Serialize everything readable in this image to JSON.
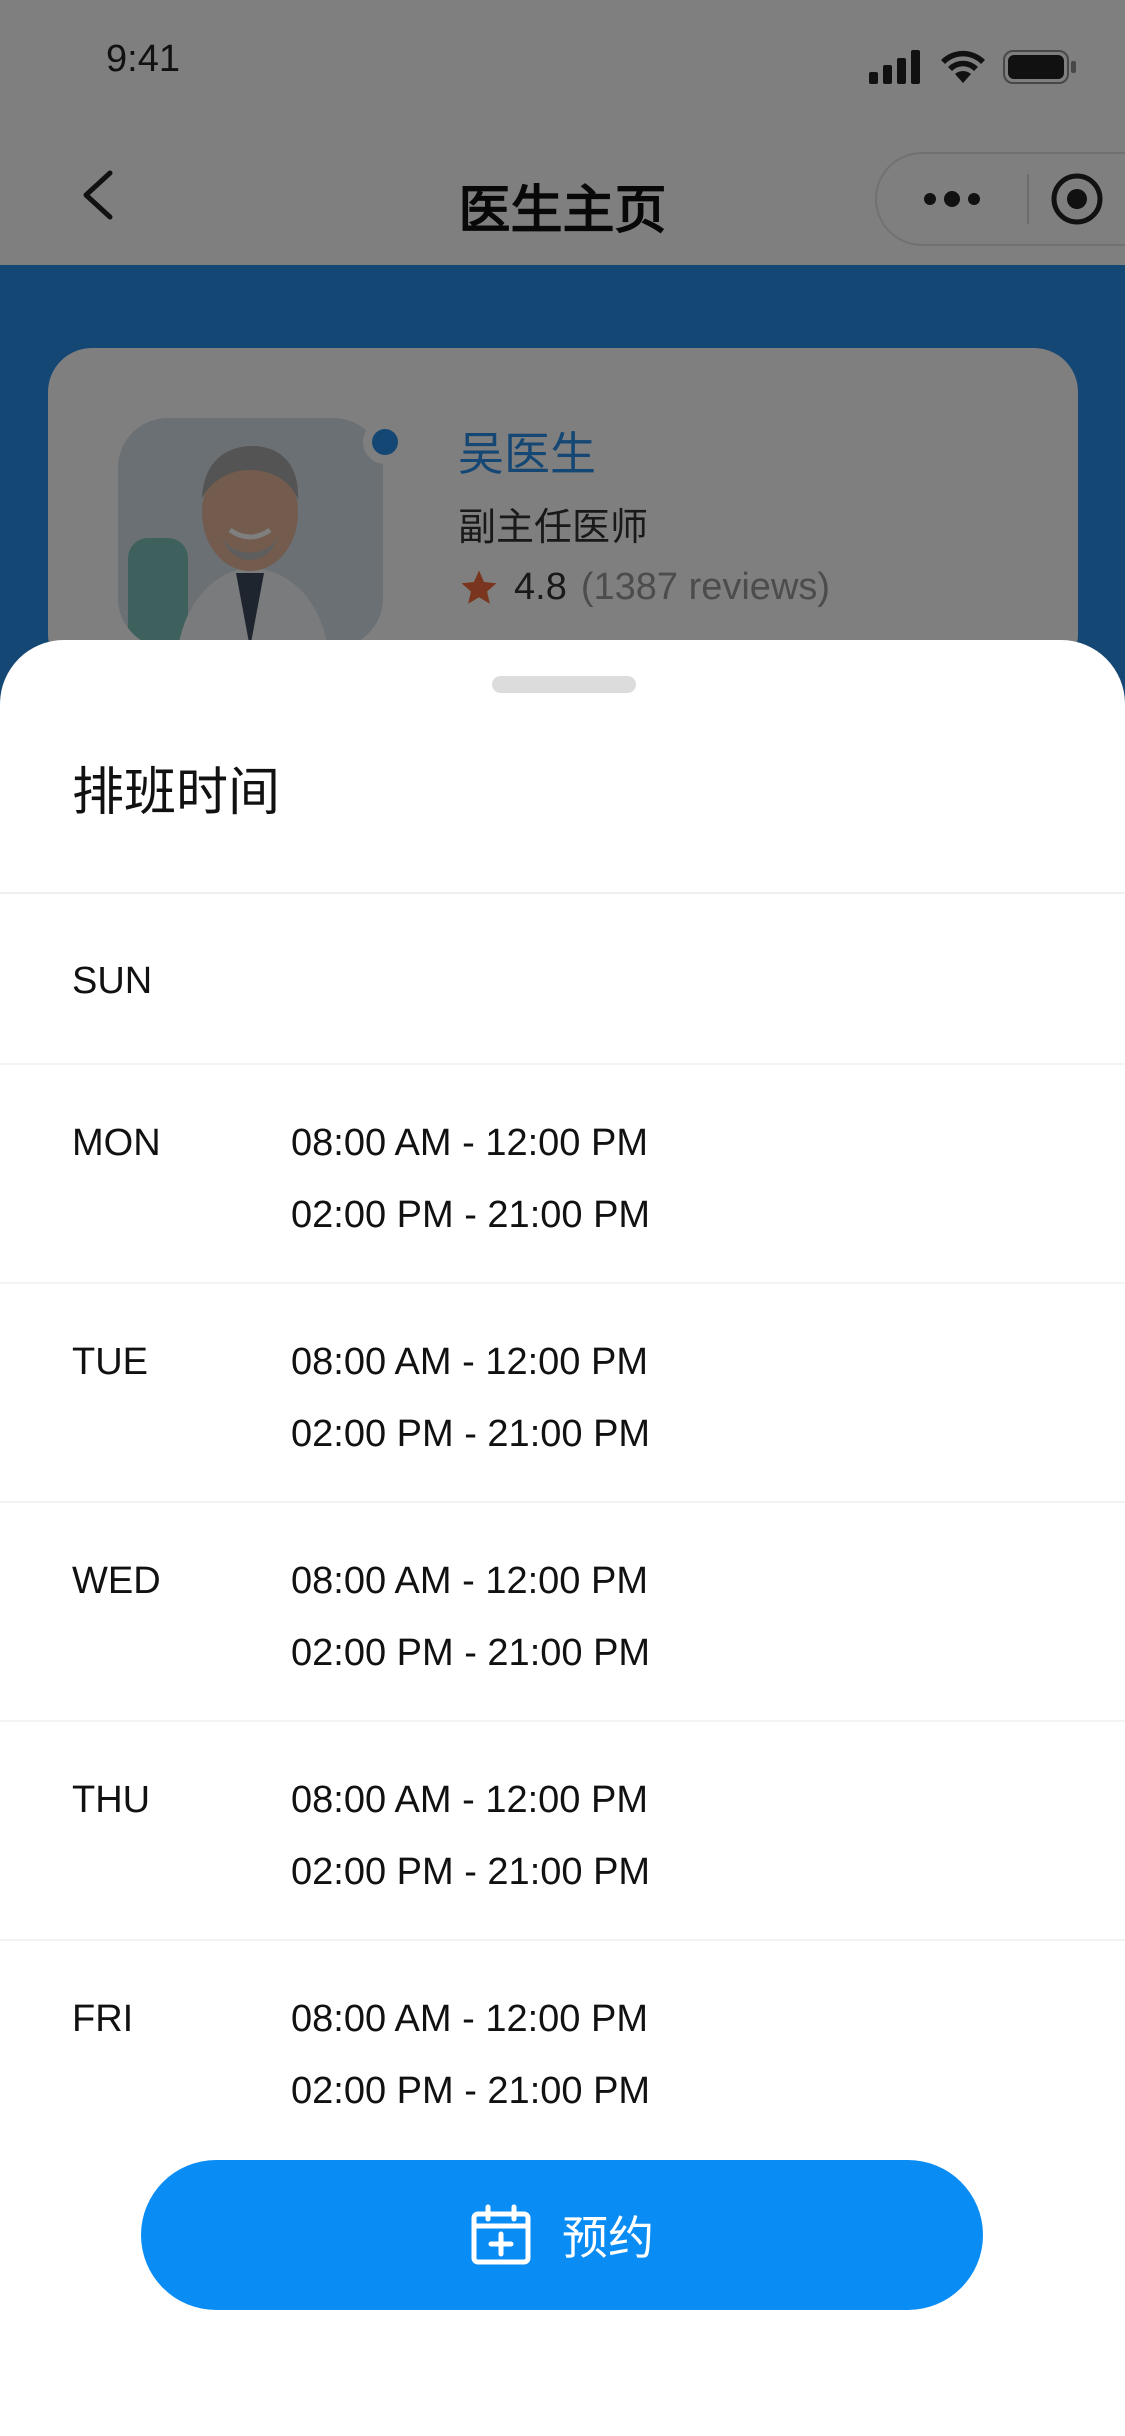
{
  "status_bar": {
    "time": "9:41"
  },
  "nav": {
    "title": "医生主页"
  },
  "doctor": {
    "name": "吴医生",
    "title": "副主任医师",
    "rating": "4.8",
    "reviews": "(1387 reviews)"
  },
  "sheet": {
    "title": "排班时间",
    "days": [
      {
        "day": "SUN",
        "slots": []
      },
      {
        "day": "MON",
        "slots": [
          "08:00 AM - 12:00 PM",
          "02:00 PM - 21:00 PM"
        ]
      },
      {
        "day": "TUE",
        "slots": [
          "08:00 AM - 12:00 PM",
          "02:00 PM - 21:00 PM"
        ]
      },
      {
        "day": "WED",
        "slots": [
          "08:00 AM - 12:00 PM",
          "02:00 PM - 21:00 PM"
        ]
      },
      {
        "day": "THU",
        "slots": [
          "08:00 AM - 12:00 PM",
          "02:00 PM - 21:00 PM"
        ]
      },
      {
        "day": "FRI",
        "slots": [
          "08:00 AM - 12:00 PM",
          "02:00 PM - 21:00 PM"
        ]
      }
    ],
    "book_label": "预约"
  },
  "colors": {
    "accent": "#0a8cf5",
    "header_blue": "#2a8ee8",
    "star": "#f26b3a"
  },
  "icons": {
    "back": "chevron-left-icon",
    "more": "more-dots-icon",
    "target": "target-icon",
    "star": "star-icon",
    "calendar": "calendar-add-icon"
  }
}
